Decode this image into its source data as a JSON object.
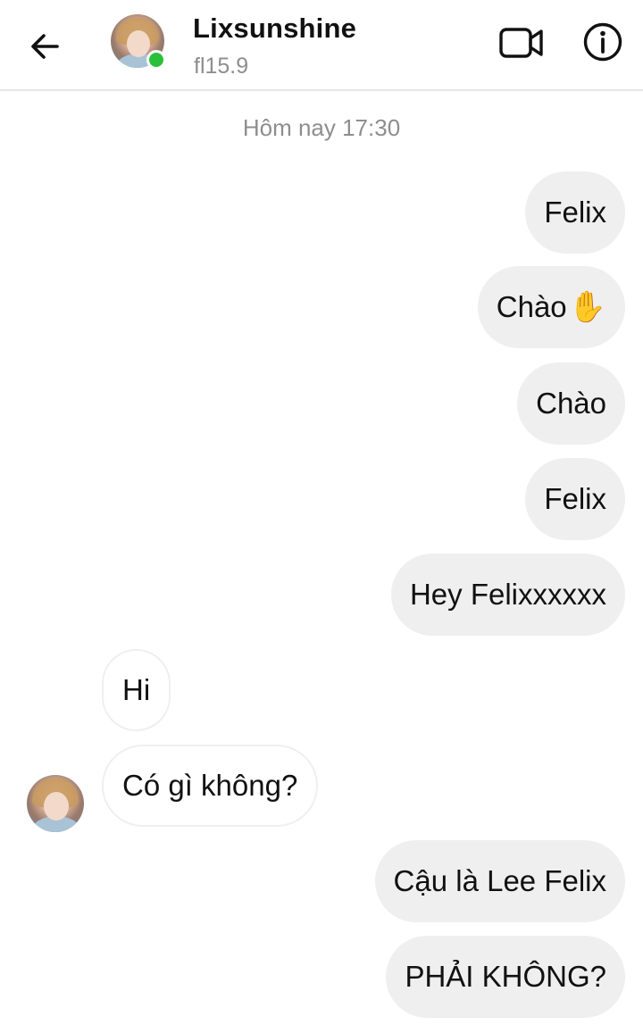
{
  "header": {
    "username": "Lixsunshine",
    "subtitle": "fl15.9",
    "online": true
  },
  "icons": {
    "back": "arrow-left-icon",
    "video": "video-camera-icon",
    "info": "info-icon",
    "wave_emoji": "✋"
  },
  "colors": {
    "online": "#2bc03a",
    "outgoing_bubble": "#efefef",
    "incoming_border": "#efefef",
    "timestamp": "#8e8e8e"
  },
  "conversation": {
    "timestamp": "Hôm nay 17:30",
    "messages": [
      {
        "direction": "out",
        "text": "Felix"
      },
      {
        "direction": "out",
        "text": "Chào",
        "emoji": "✋"
      },
      {
        "direction": "out",
        "text": "Chào"
      },
      {
        "direction": "out",
        "text": "Felix"
      },
      {
        "direction": "out",
        "text": "Hey Felixxxxxx"
      },
      {
        "direction": "in",
        "text": "Hi"
      },
      {
        "direction": "in",
        "text": "Có gì không?"
      },
      {
        "direction": "out",
        "text": "Cậu là Lee Felix"
      },
      {
        "direction": "out",
        "text": "PHẢI KHÔNG?"
      }
    ]
  }
}
